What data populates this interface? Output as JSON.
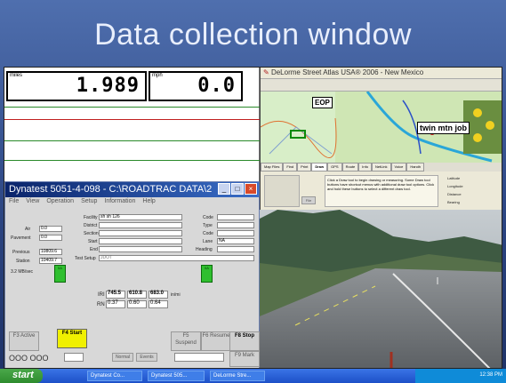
{
  "slide": {
    "title": "Data collection window"
  },
  "readouts": {
    "left": {
      "unit": "miles",
      "value": "1.989"
    },
    "right": {
      "unit": "mph",
      "value": "0.0"
    }
  },
  "dynatest": {
    "title": "Dynatest 5051-4-098 - C:\\ROADTRAC DATA\\2",
    "menu": [
      "File",
      "View",
      "Operation",
      "Setup",
      "Information",
      "Help"
    ],
    "fields": {
      "facility_label": "Facility",
      "facility_value": "sh sh 126",
      "code_label": "Code",
      "district_label": "District",
      "type_label": "Type",
      "section_label": "Section",
      "start_label": "Start",
      "lane_label": "Lane",
      "lane_value": "NA",
      "end_label": "End",
      "heading_label": "Heading",
      "test_setup_label": "Test Setup",
      "test_setup_value": "JDOT",
      "air_label": "Air",
      "air_value": "0.0",
      "pavement_label": "Pavement",
      "pavement_value": "0.0",
      "previous_label": "Previous",
      "previous_value": "10809.6",
      "station_label": "Station",
      "station_value": "10409.7",
      "rate_label": "3.2 MB/sec"
    },
    "leds": [
      {
        "text": "0A"
      },
      {
        "text": "0A"
      }
    ],
    "iri": {
      "iri_label": "IRI",
      "values": [
        "745.5",
        "610.8",
        "683.0"
      ],
      "unit": "in/mi",
      "rn_label": "RN",
      "rn_values": [
        "0.37",
        "0.60",
        "0.64"
      ]
    },
    "fkeys": {
      "f3": "F3 Active",
      "f4": "F4 Start",
      "f5": "F5 Suspend",
      "f6": "F6 Resume",
      "f8": "F8 Stop",
      "f9": "F9 Mark"
    },
    "bottom": {
      "counter": "OOO OOO",
      "normal": "Normal",
      "events": "Events"
    }
  },
  "map": {
    "title_brand": "DeLorme Street Atlas USA® 2006 - New",
    "title_suffix": "Mexico",
    "callouts": {
      "eop": "EOP",
      "twin": "twin mtn job"
    },
    "tabs": [
      "Map Files",
      "Find",
      "Print",
      "Draw",
      "GPS",
      "Route",
      "Info",
      "NetLink",
      "Voice",
      "Handh"
    ],
    "panel_text": "Click a Draw tool to begin drawing or measuring. Some Draw tool buttons have shortcut menus with additional draw tool options. Click and hold these buttons to select a different draw tool.",
    "coords": {
      "latitude": "Latitude",
      "longitude": "Longitude",
      "distance": "Distance",
      "bearing": "Bearing"
    },
    "file_button": "File"
  },
  "taskbar": {
    "start": "start",
    "tasks": [
      "Dynatest Co...",
      "Dynatest 505...",
      "DeLorme Stre..."
    ],
    "clock": "12:38 PM"
  }
}
